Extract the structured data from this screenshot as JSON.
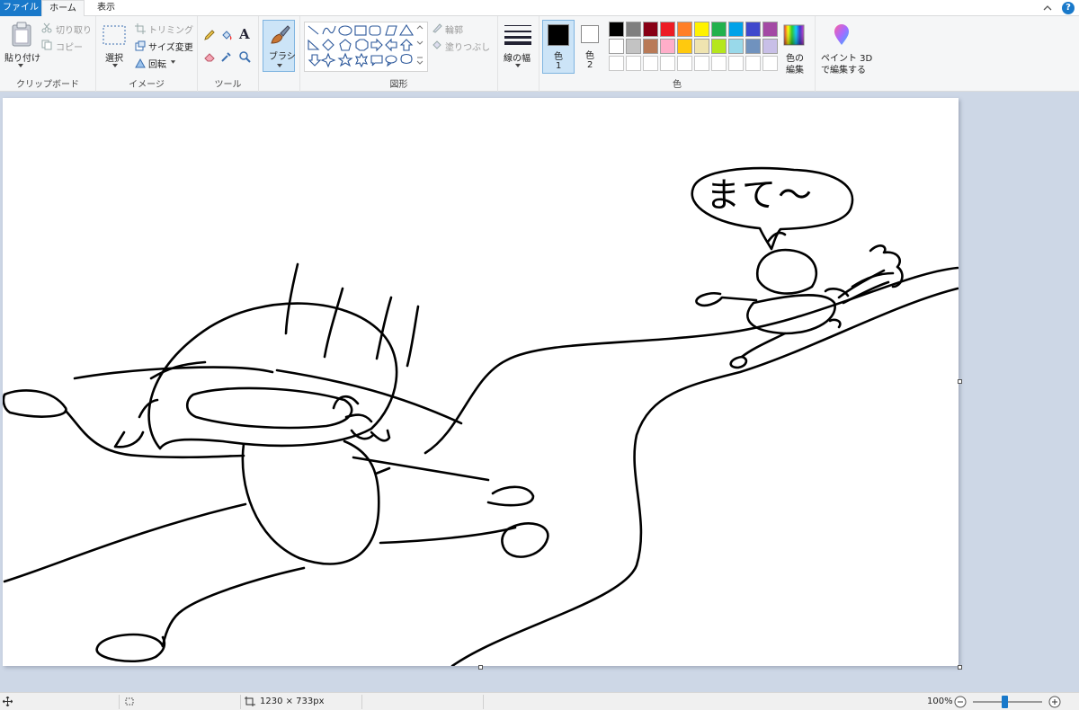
{
  "tabs": {
    "file": "ファイル",
    "home": "ホーム",
    "view": "表示"
  },
  "clipboard": {
    "paste": "貼り付け",
    "cut": "切り取り",
    "copy": "コピー",
    "group": "クリップボード"
  },
  "image": {
    "select": "選択",
    "crop": "トリミング",
    "resize": "サイズ変更",
    "rotate": "回転",
    "group": "イメージ"
  },
  "tools": {
    "group": "ツール"
  },
  "brush": {
    "label": "ブラシ"
  },
  "shapes": {
    "outline": "輪郭",
    "fill": "塗りつぶし",
    "group": "図形"
  },
  "size": {
    "label": "線の幅"
  },
  "colors": {
    "color1_label": "色",
    "color1_num": "1",
    "color2_label": "色",
    "color2_num": "2",
    "edit_line1": "色の",
    "edit_line2": "編集",
    "group": "色",
    "color1": "#000000",
    "color2": "#ffffff",
    "palette_row1": [
      "#000000",
      "#7f7f7f",
      "#880015",
      "#ed1c24",
      "#ff7f27",
      "#fff200",
      "#22b14c",
      "#00a2e8",
      "#3f48cc",
      "#a349a4"
    ],
    "palette_row2": [
      "#ffffff",
      "#c3c3c3",
      "#b97a57",
      "#ffaec9",
      "#ffc90e",
      "#efe4b0",
      "#b5e61d",
      "#99d9ea",
      "#7092be",
      "#c8bfe7"
    ]
  },
  "paint3d": {
    "line1": "ペイント 3D",
    "line2": "で編集する"
  },
  "canvas": {
    "speech_text": "まて〜"
  },
  "status": {
    "dimensions": "1230 × 733px",
    "zoom": "100%",
    "zoom_level_fraction": 0.3
  }
}
